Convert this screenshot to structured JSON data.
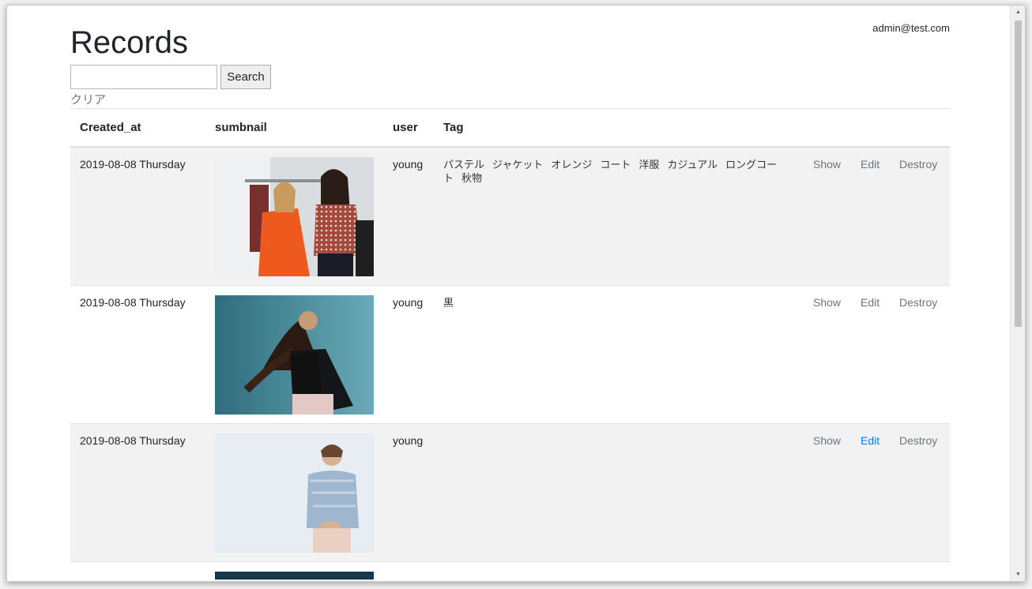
{
  "header": {
    "user_email": "admin@test.com"
  },
  "page": {
    "title": "Records"
  },
  "search": {
    "value": "",
    "placeholder": "",
    "button_label": "Search",
    "clear_label": "クリア"
  },
  "table": {
    "headers": {
      "created_at": "Created_at",
      "thumbnail": "sumbnail",
      "user": "user",
      "tag": "Tag"
    },
    "rows": [
      {
        "created_at": "2019-08-08 Thursday",
        "thumbnail_icon": "photo-two-women-with-orange-coat",
        "user": "young",
        "tags": [
          "パステル",
          "ジャケット",
          "オレンジ",
          "コート",
          "洋服",
          "カジュアル",
          "ロングコート",
          "秋物"
        ],
        "actions": {
          "show": "Show",
          "edit": "Edit",
          "destroy": "Destroy"
        }
      },
      {
        "created_at": "2019-08-08 Thursday",
        "thumbnail_icon": "photo-woman-black-top-teal-background",
        "user": "young",
        "tags": [
          "黒"
        ],
        "actions": {
          "show": "Show",
          "edit": "Edit",
          "destroy": "Destroy"
        }
      },
      {
        "created_at": "2019-08-08 Thursday",
        "thumbnail_icon": "photo-woman-light-blue-blouse",
        "user": "young",
        "tags": [],
        "actions": {
          "show": "Show",
          "edit": "Edit",
          "destroy": "Destroy"
        }
      }
    ]
  },
  "colors": {
    "link_active": "#007bff",
    "link_muted": "#6c757d",
    "stripe": "#f2f2f2"
  }
}
